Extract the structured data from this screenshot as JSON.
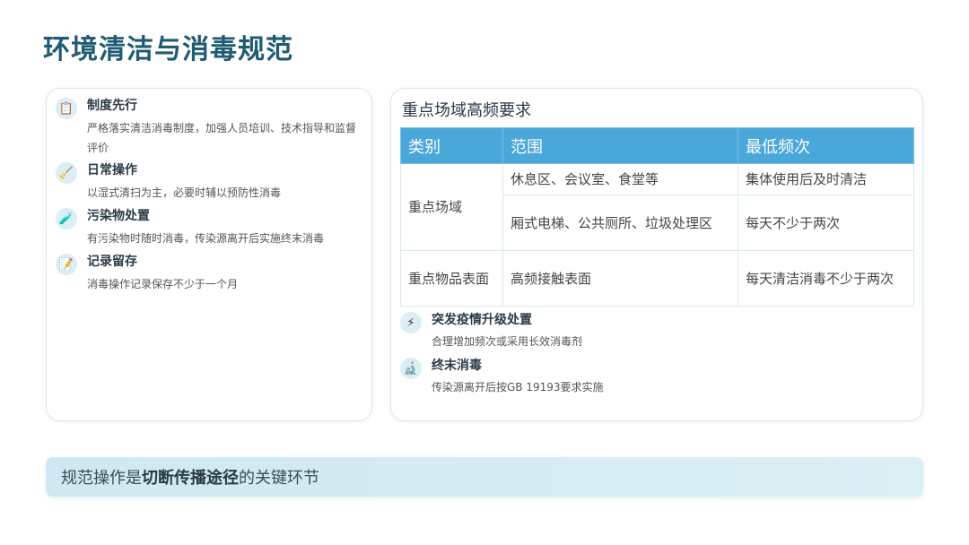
{
  "page_title": "环境清洁与消毒规范",
  "left_items": [
    {
      "icon": "clipboard-icon",
      "glyph": "📋",
      "title": "制度先行",
      "desc": "严格落实清洁消毒制度，加强人员培训、技术指导和监督评价"
    },
    {
      "icon": "broom-icon",
      "glyph": "🧹",
      "title": "日常操作",
      "desc": "以湿式清扫为主，必要时辅以预防性消毒"
    },
    {
      "icon": "test-tube-icon",
      "glyph": "🧪",
      "title": "污染物处置",
      "desc": "有污染物时随时消毒，传染源离开后实施终末消毒"
    },
    {
      "icon": "pencil-note-icon",
      "glyph": "📝",
      "title": "记录留存",
      "desc": "消毒操作记录保存不少于一个月"
    }
  ],
  "right_card": {
    "title": "重点场域高频要求",
    "table": {
      "headers": [
        "类别",
        "范围",
        "最低频次"
      ],
      "row1_category": "重点场域",
      "row1a_scope": "休息区、会议室、食堂等",
      "row1a_freq": "集体使用后及时清洁",
      "row1b_scope": "厢式电梯、公共厕所、垃圾处理区",
      "row1b_freq": "每天不少于两次",
      "row2_category": "重点物品表面",
      "row2_scope": "高频接触表面",
      "row2_freq": "每天清洁消毒不少于两次"
    },
    "items": [
      {
        "icon": "lightning-icon",
        "glyph": "⚡",
        "title": "突发疫情升级处置",
        "desc": "合理增加频次或采用长效消毒剂"
      },
      {
        "icon": "microscope-icon",
        "glyph": "🔬",
        "title": "终末消毒",
        "desc": "传染源离开后按GB 19193要求实施"
      }
    ]
  },
  "banner": {
    "prefix": "规范操作是",
    "emphasis": "切断传播途径",
    "suffix": "的关键环节"
  }
}
